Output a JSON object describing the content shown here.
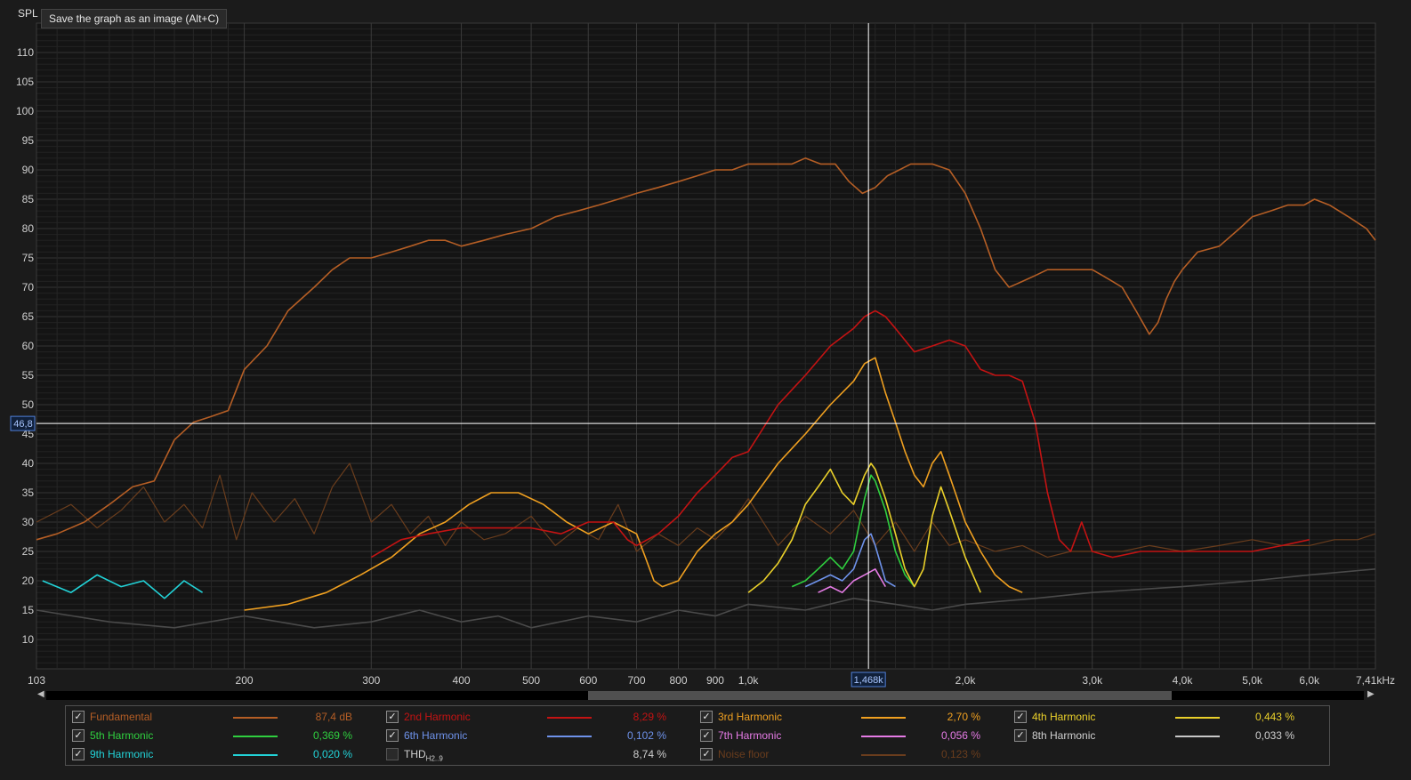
{
  "tooltip": "Save the graph as an image (Alt+C)",
  "chart_data": {
    "type": "line",
    "ylabel": "SPL",
    "x_scale": "log",
    "xlim": [
      103,
      7410
    ],
    "ylim": [
      5,
      115
    ],
    "y_ticks": [
      10,
      15,
      20,
      25,
      30,
      35,
      40,
      45,
      50,
      55,
      60,
      65,
      70,
      75,
      80,
      85,
      90,
      95,
      100,
      105,
      110
    ],
    "x_ticks": [
      {
        "v": 103,
        "label": "103"
      },
      {
        "v": 200,
        "label": "200"
      },
      {
        "v": 300,
        "label": "300"
      },
      {
        "v": 400,
        "label": "400"
      },
      {
        "v": 500,
        "label": "500"
      },
      {
        "v": 600,
        "label": "600"
      },
      {
        "v": 700,
        "label": "700"
      },
      {
        "v": 800,
        "label": "800"
      },
      {
        "v": 900,
        "label": "900"
      },
      {
        "v": 1000,
        "label": "1,0k"
      },
      {
        "v": 2000,
        "label": "2,0k"
      },
      {
        "v": 3000,
        "label": "3,0k"
      },
      {
        "v": 4000,
        "label": "4,0k"
      },
      {
        "v": 5000,
        "label": "5,0k"
      },
      {
        "v": 6000,
        "label": "6,0k"
      },
      {
        "v": 7410,
        "label": "7,41kHz"
      }
    ],
    "cursor": {
      "x": 1468,
      "x_label": "1,468k",
      "y": 46.8,
      "y_label": "46,8"
    },
    "grid": true,
    "series": [
      {
        "name": "Fundamental",
        "color": "#b55e25",
        "x": [
          103,
          110,
          120,
          130,
          140,
          150,
          160,
          170,
          180,
          190,
          200,
          215,
          230,
          250,
          265,
          280,
          300,
          320,
          340,
          360,
          380,
          400,
          430,
          460,
          500,
          540,
          580,
          620,
          660,
          700,
          750,
          800,
          850,
          900,
          950,
          1000,
          1050,
          1100,
          1150,
          1200,
          1260,
          1320,
          1380,
          1440,
          1500,
          1560,
          1620,
          1680,
          1740,
          1800,
          1900,
          2000,
          2100,
          2200,
          2300,
          2400,
          2500,
          2600,
          2700,
          2800,
          2900,
          3000,
          3100,
          3200,
          3300,
          3450,
          3600,
          3700,
          3800,
          3900,
          4000,
          4200,
          4500,
          4800,
          5000,
          5300,
          5600,
          5900,
          6100,
          6400,
          6800,
          7200,
          7410
        ],
        "y": [
          27,
          28,
          30,
          33,
          36,
          37,
          44,
          47,
          48,
          49,
          56,
          60,
          66,
          70,
          73,
          75,
          75,
          76,
          77,
          78,
          78,
          77,
          78,
          79,
          80,
          82,
          83,
          84,
          85,
          86,
          87,
          88,
          89,
          90,
          90,
          91,
          91,
          91,
          91,
          92,
          91,
          91,
          88,
          86,
          87,
          89,
          90,
          91,
          91,
          91,
          90,
          86,
          80,
          73,
          70,
          71,
          72,
          73,
          73,
          73,
          73,
          73,
          72,
          71,
          70,
          66,
          62,
          64,
          68,
          71,
          73,
          76,
          77,
          80,
          82,
          83,
          84,
          84,
          85,
          84,
          82,
          80,
          78
        ]
      },
      {
        "name": "2nd Harmonic",
        "color": "#c41313",
        "x": [
          300,
          330,
          360,
          400,
          450,
          500,
          550,
          600,
          650,
          680,
          700,
          750,
          800,
          850,
          900,
          950,
          1000,
          1100,
          1200,
          1300,
          1400,
          1450,
          1500,
          1550,
          1600,
          1700,
          1800,
          1900,
          2000,
          2100,
          2200,
          2300,
          2400,
          2500,
          2600,
          2700,
          2800,
          2900,
          3000,
          3200,
          3500,
          4000,
          4500,
          5000,
          5500,
          6000
        ],
        "y": [
          24,
          27,
          28,
          29,
          29,
          29,
          28,
          30,
          30,
          27,
          26,
          28,
          31,
          35,
          38,
          41,
          42,
          50,
          55,
          60,
          63,
          65,
          66,
          65,
          63,
          59,
          60,
          61,
          60,
          56,
          55,
          55,
          54,
          47,
          35,
          27,
          25,
          30,
          25,
          24,
          25,
          25,
          25,
          25,
          26,
          27
        ]
      },
      {
        "name": "3rd Harmonic",
        "color": "#f0a020",
        "x": [
          200,
          230,
          260,
          290,
          320,
          350,
          380,
          410,
          440,
          480,
          520,
          560,
          600,
          650,
          700,
          720,
          740,
          760,
          800,
          850,
          900,
          950,
          1000,
          1100,
          1200,
          1300,
          1400,
          1450,
          1500,
          1550,
          1600,
          1650,
          1700,
          1750,
          1800,
          1850,
          1900,
          1950,
          2000,
          2100,
          2200,
          2300,
          2400
        ],
        "y": [
          15,
          16,
          18,
          21,
          24,
          28,
          30,
          33,
          35,
          35,
          33,
          30,
          28,
          30,
          28,
          24,
          20,
          19,
          20,
          25,
          28,
          30,
          33,
          40,
          45,
          50,
          54,
          57,
          58,
          52,
          47,
          42,
          38,
          36,
          40,
          42,
          38,
          34,
          30,
          25,
          21,
          19,
          18
        ]
      },
      {
        "name": "4th Harmonic",
        "color": "#ead02a",
        "x": [
          1000,
          1050,
          1100,
          1150,
          1200,
          1250,
          1300,
          1350,
          1400,
          1450,
          1480,
          1500,
          1550,
          1600,
          1650,
          1700,
          1750,
          1800,
          1850,
          1900,
          2000,
          2100
        ],
        "y": [
          18,
          20,
          23,
          27,
          33,
          36,
          39,
          35,
          33,
          38,
          40,
          39,
          34,
          28,
          22,
          19,
          22,
          31,
          36,
          32,
          24,
          18
        ]
      },
      {
        "name": "5th Harmonic",
        "color": "#2fcf3f",
        "x": [
          1150,
          1200,
          1250,
          1300,
          1350,
          1400,
          1450,
          1480,
          1500,
          1550,
          1600,
          1650,
          1700
        ],
        "y": [
          19,
          20,
          22,
          24,
          22,
          25,
          34,
          38,
          37,
          32,
          25,
          21,
          19
        ]
      },
      {
        "name": "6th Harmonic",
        "color": "#6e92ea",
        "x": [
          1200,
          1250,
          1300,
          1350,
          1400,
          1450,
          1480,
          1500,
          1550,
          1600
        ],
        "y": [
          19,
          20,
          21,
          20,
          22,
          27,
          28,
          26,
          20,
          19
        ]
      },
      {
        "name": "7th Harmonic",
        "color": "#e57be5",
        "x": [
          1250,
          1300,
          1350,
          1400,
          1450,
          1500,
          1550
        ],
        "y": [
          18,
          19,
          18,
          20,
          21,
          22,
          19
        ]
      },
      {
        "name": "9th Harmonic",
        "color": "#22d3d8",
        "x": [
          105,
          115,
          125,
          135,
          145,
          155,
          165,
          175
        ],
        "y": [
          20,
          18,
          21,
          19,
          20,
          17,
          20,
          18
        ]
      },
      {
        "name": "Noise floor",
        "color": "#6a3d1d",
        "x": [
          103,
          115,
          125,
          135,
          145,
          155,
          165,
          175,
          185,
          195,
          205,
          220,
          235,
          250,
          265,
          280,
          300,
          320,
          340,
          360,
          380,
          400,
          430,
          460,
          500,
          540,
          580,
          620,
          660,
          700,
          750,
          800,
          850,
          900,
          950,
          1000,
          1100,
          1200,
          1300,
          1400,
          1500,
          1600,
          1700,
          1800,
          1900,
          2000,
          2200,
          2400,
          2600,
          2800,
          3000,
          3300,
          3600,
          4000,
          4500,
          5000,
          5500,
          6000,
          6500,
          7000,
          7410
        ],
        "y": [
          30,
          33,
          29,
          32,
          36,
          30,
          33,
          29,
          38,
          27,
          35,
          30,
          34,
          28,
          36,
          40,
          30,
          33,
          28,
          31,
          26,
          30,
          27,
          28,
          31,
          26,
          29,
          27,
          33,
          25,
          28,
          26,
          29,
          27,
          30,
          34,
          26,
          31,
          28,
          32,
          26,
          30,
          25,
          30,
          26,
          27,
          25,
          26,
          24,
          25,
          25,
          25,
          26,
          25,
          26,
          27,
          26,
          26,
          27,
          27,
          28
        ]
      },
      {
        "name": "8th Harmonic",
        "color": "#4a4a4a",
        "x": [
          103,
          130,
          160,
          200,
          250,
          300,
          350,
          400,
          450,
          500,
          600,
          700,
          800,
          900,
          1000,
          1200,
          1400,
          1600,
          1800,
          2000,
          2500,
          3000,
          4000,
          5000,
          6000,
          7410
        ],
        "y": [
          15,
          13,
          12,
          14,
          12,
          13,
          15,
          13,
          14,
          12,
          14,
          13,
          15,
          14,
          16,
          15,
          17,
          16,
          15,
          16,
          17,
          18,
          19,
          20,
          21,
          22
        ]
      }
    ]
  },
  "legend": [
    {
      "name": "Fundamental",
      "value": "87,4 dB",
      "color": "#b55e25",
      "checked": true
    },
    {
      "name": "2nd Harmonic",
      "value": "8,29 %",
      "color": "#c41313",
      "checked": true
    },
    {
      "name": "3rd Harmonic",
      "value": "2,70 %",
      "color": "#f0a020",
      "checked": true
    },
    {
      "name": "4th Harmonic",
      "value": "0,443 %",
      "color": "#ead02a",
      "checked": true
    },
    {
      "name": "5th Harmonic",
      "value": "0,369 %",
      "color": "#2fcf3f",
      "checked": true
    },
    {
      "name": "6th Harmonic",
      "value": "0,102 %",
      "color": "#6e92ea",
      "checked": true
    },
    {
      "name": "7th Harmonic",
      "value": "0,056 %",
      "color": "#e57be5",
      "checked": true
    },
    {
      "name": "8th Harmonic",
      "value": "0,033 %",
      "color": "#c8c8c8",
      "checked": true
    },
    {
      "name": "9th Harmonic",
      "value": "0,020 %",
      "color": "#22d3d8",
      "checked": true
    },
    {
      "name": "THD",
      "sub": "H2..9",
      "value": "8,74 %",
      "color": "#cfcfcf",
      "checked": false
    },
    {
      "name": "Noise floor",
      "value": "0,123 %",
      "color": "#6a3d1d",
      "checked": true
    }
  ]
}
